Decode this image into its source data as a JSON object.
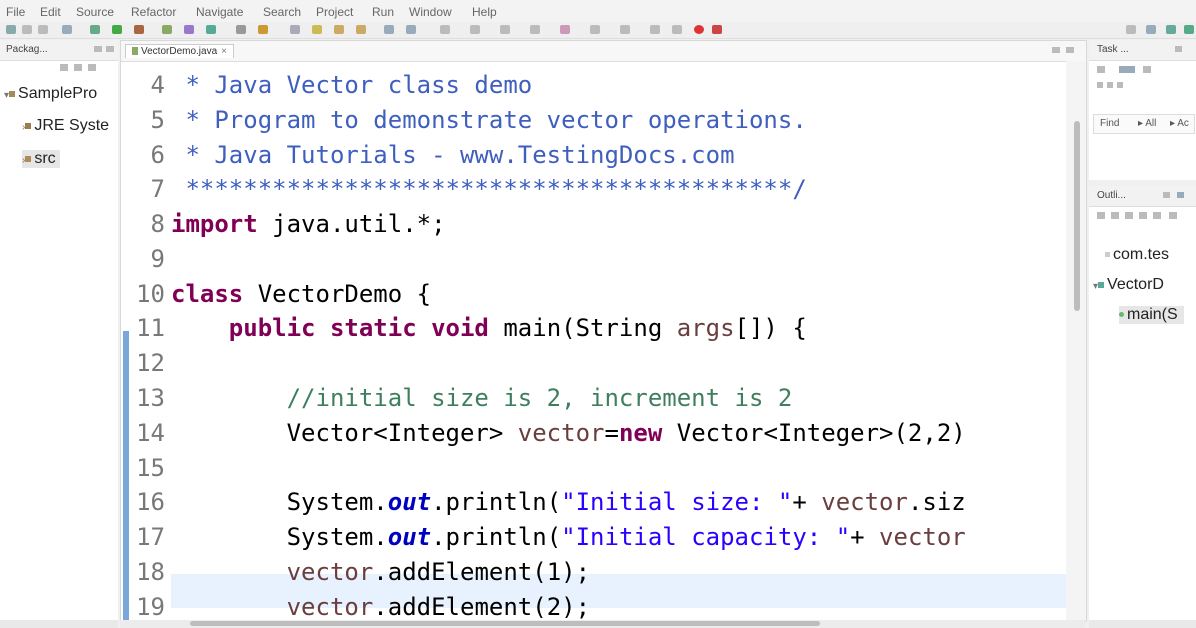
{
  "menu": [
    "File",
    "Edit",
    "Source",
    "Refactor",
    "Navigate",
    "Search",
    "Project",
    "Run",
    "Window",
    "Help"
  ],
  "package_explorer": {
    "tab_label": "Packag...",
    "items": [
      {
        "label": "SamplePro",
        "icon": "project-folder-icon"
      },
      {
        "label": "JRE Syste",
        "icon": "library-icon"
      },
      {
        "label": "src",
        "icon": "source-folder-icon"
      }
    ]
  },
  "editor": {
    "tab_label": "VectorDemo.java",
    "line_numbers": [
      "4",
      "5",
      "6",
      "7",
      "8",
      "9",
      "10",
      "11",
      "12",
      "13",
      "14",
      "15",
      "16",
      "17",
      "18",
      "19"
    ],
    "lines": {
      "l4": " * Java Vector class demo",
      "l5": " * Program to demonstrate vector operations.",
      "l6": " * Java Tutorials - www.TestingDocs.com",
      "l7": " ******************************************/",
      "l8_kw": "import",
      "l8_rest": " java.util.*;",
      "l10_kw": "class",
      "l10_rest": " VectorDemo {",
      "l11_indent": "    ",
      "l11_kw": "public static void",
      "l11_a": " main(String ",
      "l11_var": "args",
      "l11_b": "[]) {",
      "l13_indent": "        ",
      "l13_comment": "//initial size is 2, increment is 2",
      "l14_indent": "        ",
      "l14_a": "Vector<Integer> ",
      "l14_var": "vector",
      "l14_b": "=",
      "l14_kw": "new",
      "l14_c": " Vector<Integer>(2,2)",
      "l16_indent": "        ",
      "l16_a": "System.",
      "l16_field": "out",
      "l16_b": ".println(",
      "l16_str": "\"Initial size: \"",
      "l16_c": "+ ",
      "l16_var": "vector",
      "l16_d": ".siz",
      "l17_indent": "        ",
      "l17_a": "System.",
      "l17_field": "out",
      "l17_b": ".println(",
      "l17_str": "\"Initial capacity: \"",
      "l17_c": "+ ",
      "l17_var": "vector",
      "l18_indent": "        ",
      "l18_var": "vector",
      "l18_rest": ".addElement(1);",
      "l19_indent": "        ",
      "l19_var": "vector",
      "l19_rest": ".addElement(2);"
    }
  },
  "task_list": {
    "tab_label": "Task ...",
    "find_label": "Find",
    "all_label": "▸ All",
    "activate_label": "▸ Ac"
  },
  "outline": {
    "tab_label": "Outli...",
    "items": [
      {
        "label": "com.tes",
        "icon": "package-icon"
      },
      {
        "label": "VectorD",
        "icon": "class-icon"
      },
      {
        "label": "main(S",
        "icon": "method-icon"
      }
    ]
  },
  "colors": {
    "keyword": "#7f0055",
    "comment": "#3f5fbf",
    "line_comment": "#3f7f5f",
    "string": "#2a00ff",
    "variable": "#6a3e3e",
    "highlight_line": "#e8f2fe"
  }
}
